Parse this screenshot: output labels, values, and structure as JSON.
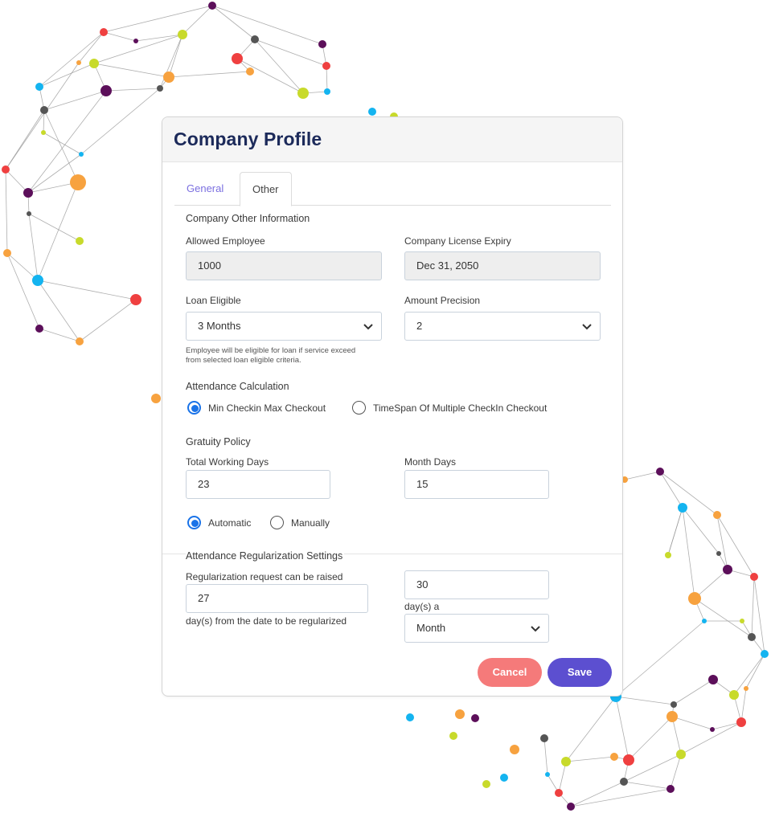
{
  "dialog": {
    "title": "Company Profile",
    "tabs": [
      {
        "label": "General",
        "active": false
      },
      {
        "label": "Other",
        "active": true
      }
    ],
    "section_title": "Company Other Information",
    "allowed_employee": {
      "label": "Allowed Employee",
      "value": "1000",
      "disabled": true
    },
    "license_expiry": {
      "label": "Company License Expiry",
      "value": "Dec 31, 2050",
      "disabled": true
    },
    "loan_eligible": {
      "label": "Loan Eligible",
      "value": "3 Months",
      "hint_line1": "Employee will be eligible for loan if service exceed",
      "hint_line2": "from selected loan eligible criteria."
    },
    "amount_precision": {
      "label": "Amount Precision",
      "value": "2"
    },
    "attendance_calculation": {
      "title": "Attendance Calculation",
      "options": [
        {
          "label": "Min Checkin Max Checkout",
          "selected": true
        },
        {
          "label": "TimeSpan Of Multiple CheckIn Checkout",
          "selected": false
        }
      ]
    },
    "gratuity_policy": {
      "title": "Gratuity Policy",
      "total_working_days": {
        "label": "Total Working Days",
        "value": "23"
      },
      "month_days": {
        "label": "Month Days",
        "value": "15"
      },
      "options": [
        {
          "label": "Automatic",
          "selected": true
        },
        {
          "label": "Manually",
          "selected": false
        }
      ]
    },
    "regularization": {
      "title": "Attendance Regularization Settings",
      "request_label": "Regularization request can be raised",
      "request_value": "27",
      "request_suffix": "day(s) from the date to be regularized",
      "limit_value": "30",
      "limit_suffix": "day(s) a",
      "period_value": "Month"
    },
    "buttons": {
      "cancel": "Cancel",
      "save": "Save"
    }
  },
  "colors": {
    "title": "#1c2a5a",
    "tab_inactive": "#7b6fe0",
    "radio_selected": "#1a73e8",
    "cancel": "#f57a7a",
    "save": "#5c4fd0"
  }
}
